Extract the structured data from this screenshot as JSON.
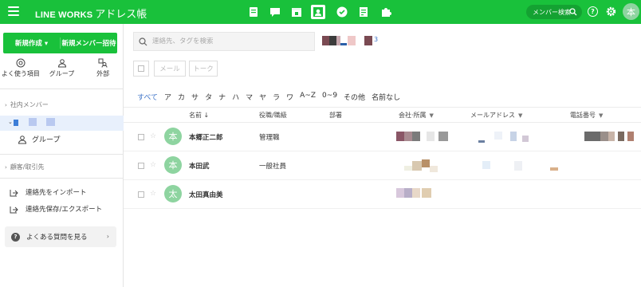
{
  "topbar": {
    "brand": "LINE WORKS",
    "app_name": "アドレス帳",
    "search_label": "メンバー検索",
    "help_symbol": "?",
    "user_initial": "本",
    "app_icons": [
      "board-icon",
      "talk-icon",
      "calendar-icon",
      "contacts-icon",
      "task-icon",
      "form-icon",
      "plugin-icon"
    ]
  },
  "sidebar": {
    "new_button": "新規作成 ▾",
    "invite_button": "新規メンバー招待",
    "quick": [
      {
        "icon": "frequent-icon",
        "label": "よく使う項目"
      },
      {
        "icon": "group-icon",
        "label": "グループ"
      },
      {
        "icon": "external-icon",
        "label": "外部"
      }
    ],
    "internal_section": "社内メンバー",
    "group_label": "グループ",
    "customer_section": "顧客/取引先",
    "import_label": "連絡先をインポート",
    "export_label": "連絡先保存/エクスポート",
    "faq_label": "よくある質問を見る",
    "faq_chevron": "›"
  },
  "main": {
    "search_placeholder": "連絡先、タグを検索",
    "result_count": "3",
    "mail_button": "メール",
    "talk_button": "トーク",
    "alpha_filter": [
      "すべて",
      "ア",
      "カ",
      "サ",
      "タ",
      "ナ",
      "ハ",
      "マ",
      "ヤ",
      "ラ",
      "ワ",
      "A~Z",
      "0~9",
      "その他",
      "名前なし"
    ],
    "columns": {
      "name": "名前 ↓",
      "title": "役職/職級",
      "dept": "部署",
      "company": "会社·所属",
      "email": "メールアドレス",
      "phone": "電話番号"
    },
    "rows": [
      {
        "initial": "本",
        "name": "本郷正二郎",
        "title": "管理職"
      },
      {
        "initial": "本",
        "name": "本田武",
        "title": "一般社員"
      },
      {
        "initial": "太",
        "name": "太田真由美",
        "title": ""
      }
    ],
    "filter_symbol": "▼",
    "star_symbol": "☆",
    "colors": {
      "accent": "#19c13b",
      "avatar": "#8ed4a0",
      "link": "#3f74c8"
    }
  }
}
